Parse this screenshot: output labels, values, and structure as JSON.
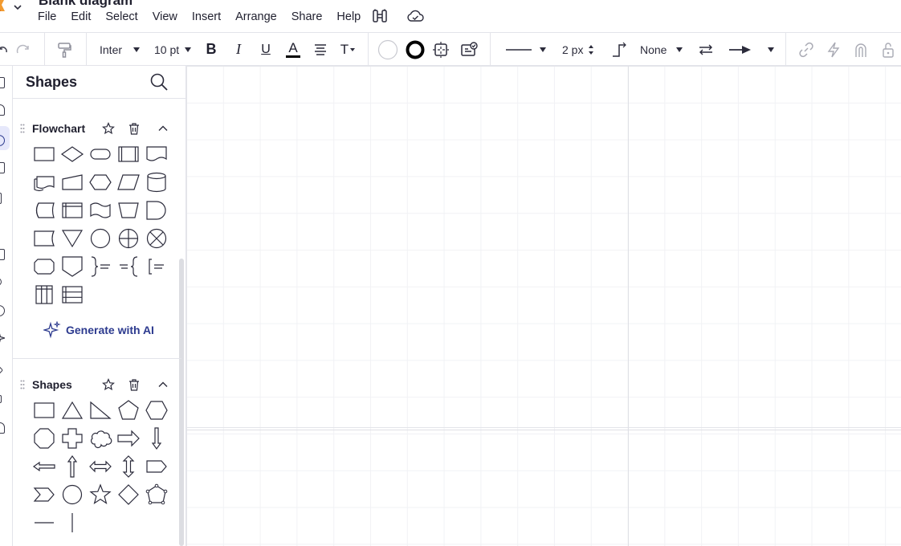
{
  "app": {
    "document_title": "Blank diagram",
    "menu": [
      "File",
      "Edit",
      "Select",
      "View",
      "Insert",
      "Arrange",
      "Share",
      "Help"
    ]
  },
  "toolbar": {
    "font_family": "Inter",
    "font_size": "10 pt",
    "bold_label": "B",
    "italic_label": "I",
    "underline_label": "U",
    "font_color_label": "A",
    "text_options_label": "T",
    "line_width": "2 px",
    "line_end_style": "None"
  },
  "shapes_panel": {
    "title": "Shapes",
    "flowchart_group": {
      "title": "Flowchart",
      "generate_label": "Generate with AI"
    },
    "basic_group": {
      "title": "Shapes"
    }
  },
  "colors": {
    "accent": "#2d3b8f",
    "rail_active": "#e6e8fb",
    "border": "#e3e4ea",
    "text": "#1f1f2e",
    "logo": "#f29b30"
  }
}
